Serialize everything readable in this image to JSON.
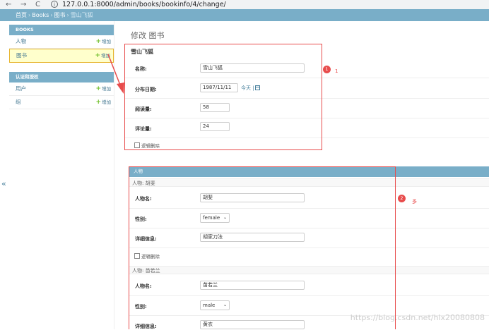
{
  "browser": {
    "back": "←",
    "forward": "→",
    "reload": "C",
    "info": "i",
    "url": "127.0.0.1:8000/admin/books/bookinfo/4/change/"
  },
  "breadcrumb": {
    "home": "首页",
    "app": "Books",
    "model": "图书",
    "current": "雪山飞狐",
    "sep": "›"
  },
  "sidebar": {
    "modules": [
      {
        "caption": "BOOKS",
        "items": [
          {
            "label": "人物",
            "add": "增加"
          },
          {
            "label": "图书",
            "add": "增加"
          }
        ]
      },
      {
        "caption": "认证和授权",
        "items": [
          {
            "label": "用户",
            "add": "增加"
          },
          {
            "label": "组",
            "add": "增加"
          }
        ]
      }
    ],
    "collapse": "«"
  },
  "page": {
    "title": "修改 图书",
    "object_title": "雪山飞狐"
  },
  "book_form": {
    "name_label": "名称:",
    "name_value": "雪山飞狐",
    "pub_date_label": "分布日期:",
    "pub_date_value": "1987/11/11",
    "today_label": "今天 |",
    "read_label": "阅读量:",
    "read_value": "58",
    "comment_label": "评论量:",
    "comment_value": "24",
    "delete_label": "逻辑删除"
  },
  "inline": {
    "caption": "人物",
    "entries": [
      {
        "title": "人物: 胡斐",
        "name_label": "人物名:",
        "name_value": "胡斐",
        "gender_label": "性别:",
        "gender_value": "female",
        "detail_label": "详细信息:",
        "detail_value": "胡家刀法",
        "delete_label": "逻辑删除"
      },
      {
        "title": "人物: 苗若兰",
        "name_label": "人物名:",
        "name_value": "苗若兰",
        "gender_label": "性别:",
        "gender_value": "male",
        "detail_label": "详细信息:",
        "detail_value": "黄衣"
      }
    ]
  },
  "annotations": {
    "one_num": "1",
    "one_text": "1",
    "two_num": "2",
    "two_text": "多"
  },
  "watermark": "https://blog.csdn.net/hlx20080808",
  "colors": {
    "header": "#79aec8",
    "link": "#417690",
    "add_plus": "#70bf2b",
    "annotation": "#e84c4c",
    "active_row": "#ffffcc"
  }
}
